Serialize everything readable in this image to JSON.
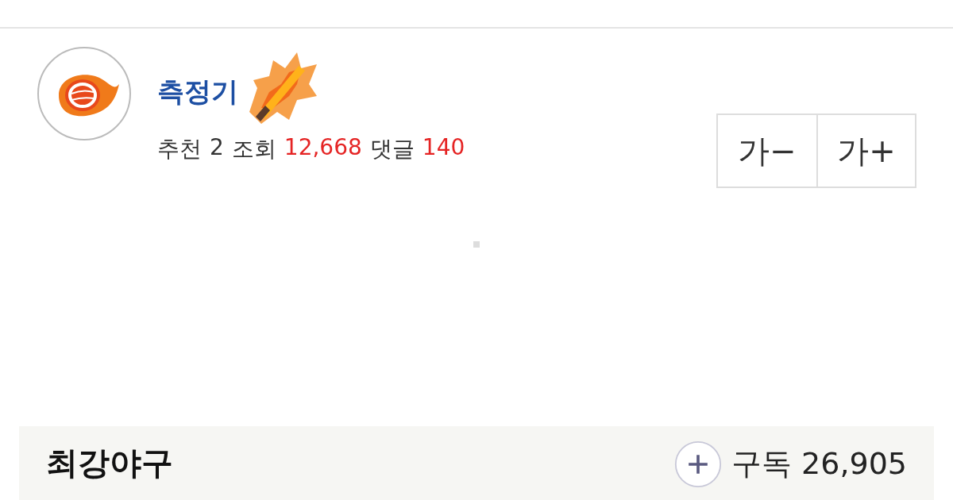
{
  "author": {
    "name": "측정기"
  },
  "stats": [
    {
      "label": "추천",
      "value": "2",
      "highlight": false
    },
    {
      "label": "조회",
      "value": "12,668",
      "highlight": true
    },
    {
      "label": "댓글",
      "value": "140",
      "highlight": true
    }
  ],
  "font_buttons": [
    "가−",
    "가+"
  ],
  "channel": {
    "name": "최강야구",
    "subscribe_label": "구독",
    "subscribers": "26,905"
  }
}
